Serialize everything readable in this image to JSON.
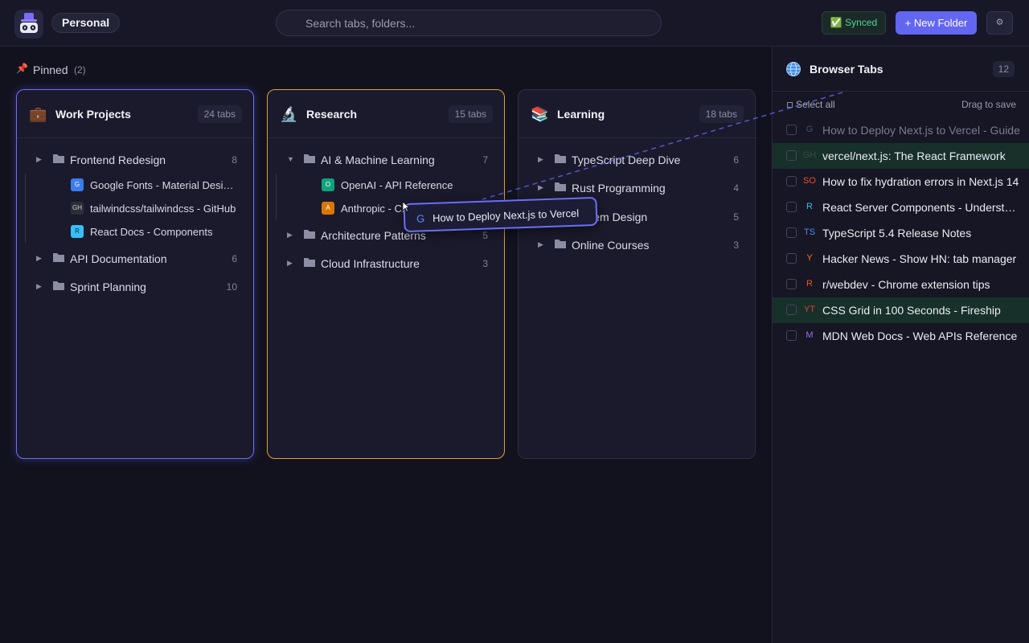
{
  "header": {
    "workspace": "Personal",
    "search_placeholder": "Search tabs, folders...",
    "sync_status": "✅ Synced",
    "new_folder_label": "+ New Folder",
    "settings_icon": "⚙"
  },
  "pinned": {
    "icon": "📌",
    "label": "Pinned",
    "count": "(2)"
  },
  "cards": [
    {
      "icon": "💼",
      "title": "Work Projects",
      "count": "24 tabs",
      "folders": [
        {
          "name": "Frontend Redesign",
          "count": "8",
          "caret": "▶",
          "tabs": [
            {
              "favicon": "G",
              "title": "Google Fonts - Material Design Icons",
              "color": "#3b7cf0"
            },
            {
              "favicon": "GH",
              "title": "tailwindcss/tailwindcss - GitHub",
              "color": "#2e2e38"
            },
            {
              "favicon": "R",
              "title": "React Docs - Components",
              "color": "#38bdf8"
            }
          ]
        },
        {
          "name": "API Documentation",
          "count": "6",
          "caret": "▶"
        },
        {
          "name": "Sprint Planning",
          "count": "10",
          "caret": "▶"
        }
      ]
    },
    {
      "icon": "🔬",
      "title": "Research",
      "count": "15 tabs",
      "folders": [
        {
          "name": "AI & Machine Learning",
          "count": "7",
          "caret": "▼",
          "tabs": [
            {
              "favicon": "O",
              "title": "OpenAI - API Reference",
              "color": "#10a37f"
            },
            {
              "favicon": "A",
              "title": "Anthropic - Claude",
              "color": "#d97706"
            }
          ]
        },
        {
          "name": "Architecture Patterns",
          "count": "5",
          "caret": "▶"
        },
        {
          "name": "Cloud Infrastructure",
          "count": "3",
          "caret": "▶"
        }
      ]
    },
    {
      "icon": "📚",
      "title": "Learning",
      "count": "18 tabs",
      "folders": [
        {
          "name": "TypeScript Deep Dive",
          "count": "6",
          "caret": "▶"
        },
        {
          "name": "Rust Programming",
          "count": "4",
          "caret": "▶"
        },
        {
          "name": "System Design",
          "count": "5",
          "caret": "▶"
        },
        {
          "name": "Online Courses",
          "count": "3",
          "caret": "▶"
        }
      ]
    }
  ],
  "drag_preview": {
    "favicon": "G",
    "title": "How to Deploy Next.js to Vercel"
  },
  "panel": {
    "title": "Browser Tabs",
    "count": "12",
    "select_all": "Select all",
    "drag_hint": "Drag to save",
    "tabs": [
      {
        "favicon": "G",
        "title": "How to Deploy Next.js to Vercel - Guide",
        "color": "#6f86c9",
        "state": "dragging"
      },
      {
        "favicon": "GH",
        "title": "vercel/next.js: The React Framework",
        "color": "#5a5a70",
        "state": "highlighted"
      },
      {
        "favicon": "SO",
        "title": "How to fix hydration errors in Next.js 14",
        "color": "#f07b2e",
        "state": "normal"
      },
      {
        "favicon": "R",
        "title": "React Server Components - Understanding RSC",
        "color": "#38bdf8",
        "state": "normal"
      },
      {
        "favicon": "TS",
        "title": "TypeScript 5.4 Release Notes",
        "color": "#4f8ff0",
        "state": "normal"
      },
      {
        "favicon": "Y",
        "title": "Hacker News - Show HN: tab manager",
        "color": "#ff7a1a",
        "state": "normal"
      },
      {
        "favicon": "R",
        "title": "r/webdev - Chrome extension tips",
        "color": "#ff4b1f",
        "state": "normal"
      },
      {
        "favicon": "YT",
        "title": "CSS Grid in 100 Seconds - Fireship",
        "color": "#e53935",
        "state": "highlighted"
      },
      {
        "favicon": "M",
        "title": "MDN Web Docs - Web APIs Reference",
        "color": "#a36bf0",
        "state": "normal"
      }
    ]
  }
}
